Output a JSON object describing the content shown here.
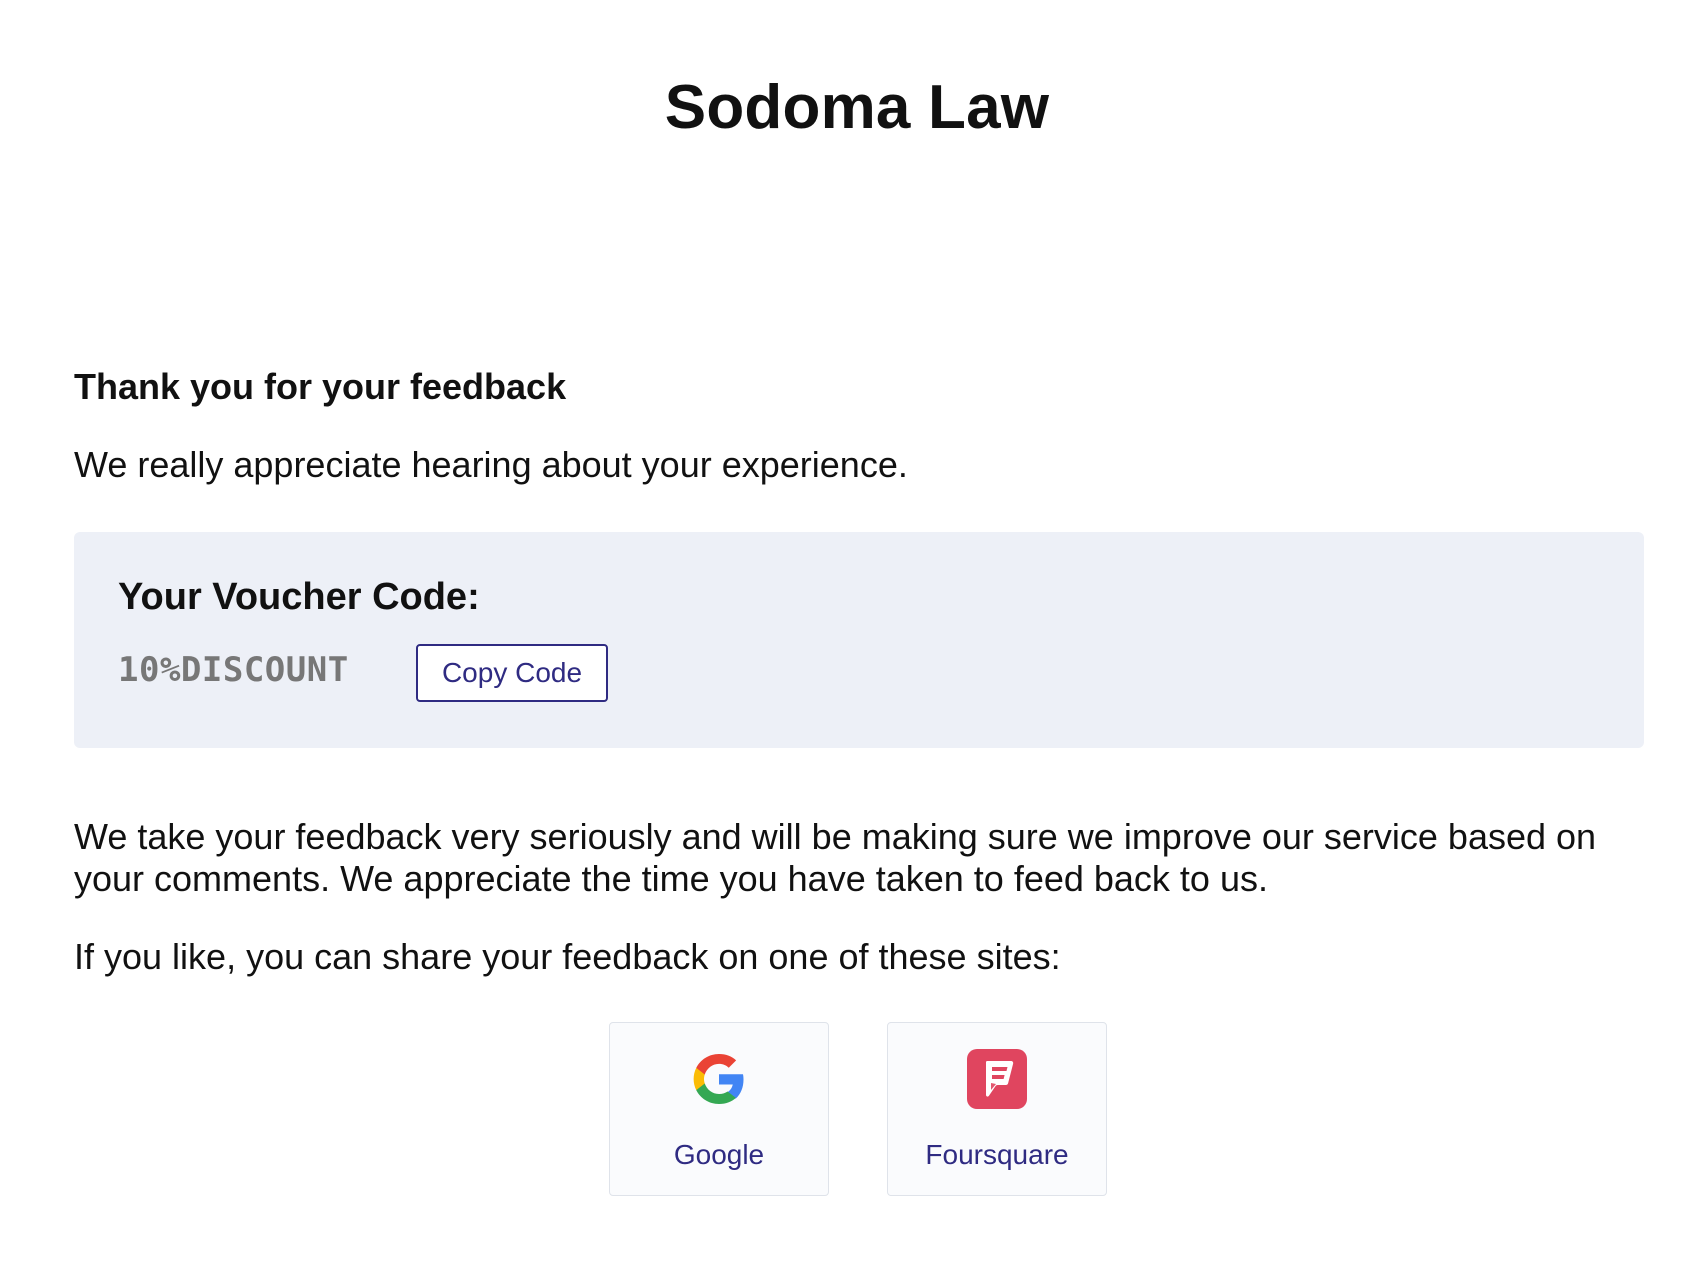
{
  "header": {
    "brand": "Sodoma Law"
  },
  "thank_you": {
    "title": "Thank you for your feedback",
    "message": "We really appreciate hearing about your experience."
  },
  "voucher": {
    "title": "Your Voucher Code:",
    "code": "10%DISCOUNT",
    "copy_label": "Copy Code"
  },
  "body": {
    "paragraph": "We take your feedback very seriously and will be making sure we improve our service based on your comments. We appreciate the time you have taken to feed back to us.",
    "share_prompt": "If you like, you can share your feedback on one of these sites:"
  },
  "sites": [
    {
      "label": "Google",
      "icon": "google-icon"
    },
    {
      "label": "Foursquare",
      "icon": "foursquare-icon"
    }
  ],
  "colors": {
    "accent": "#2f2b82",
    "voucher_bg": "#edf0f7",
    "foursquare": "#e0455f"
  }
}
